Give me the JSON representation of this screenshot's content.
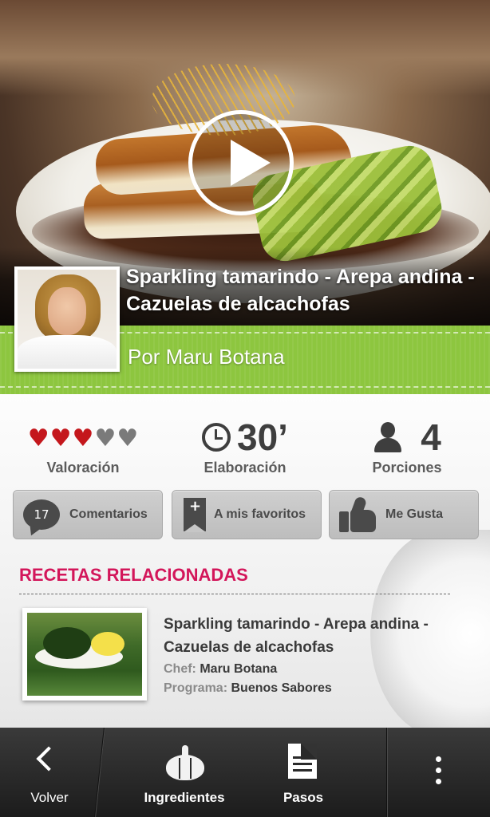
{
  "hero": {
    "recipe_title": "Sparkling tamarindo - Arepa andina - Cazuelas de alcachofas",
    "by_line": "Por Maru Botana",
    "play_icon": "play-icon"
  },
  "stats": {
    "rating_label": "Valoración",
    "rating_value": 3,
    "rating_max": 5,
    "time_value": "30’",
    "time_label": "Elaboración",
    "portions_value": "4",
    "portions_label": "Porciones"
  },
  "actions": {
    "comments_count": "17",
    "comments_label": "Comentarios",
    "favorites_label": "A mis favoritos",
    "like_label": "Me Gusta"
  },
  "related": {
    "heading": "RECETAS RELACIONADAS",
    "items": [
      {
        "title": "Sparkling tamarindo - Arepa andina - Cazuelas de alcachofas",
        "chef_key": "Chef:",
        "chef": "Maru Botana",
        "program_key": "Programa:",
        "program": "Buenos Sabores"
      }
    ]
  },
  "bottom_bar": {
    "back_label": "Volver",
    "ingredients_label": "Ingredientes",
    "steps_label": "Pasos"
  },
  "colors": {
    "accent_green": "#8dc63f",
    "related_heading": "#d3165a",
    "heart_on": "#c4171c",
    "heart_off": "#7a7a7a"
  }
}
